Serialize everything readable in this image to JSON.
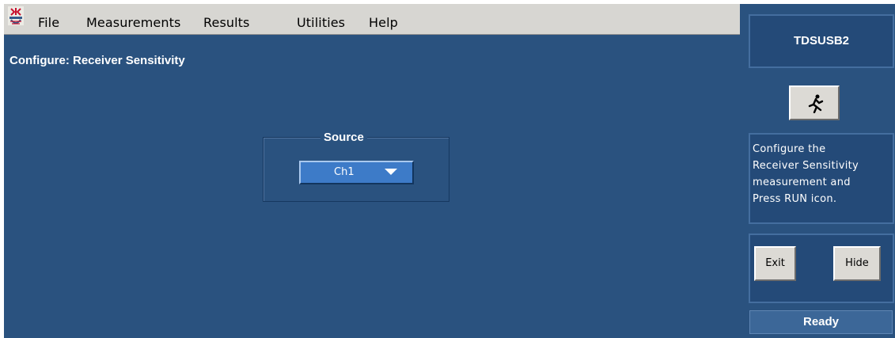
{
  "menu": {
    "items": [
      "File",
      "Measurements",
      "Results",
      "Utilities",
      "Help"
    ]
  },
  "main": {
    "title": "Configure: Receiver Sensitivity",
    "source": {
      "label": "Source",
      "selected": "Ch1"
    }
  },
  "sidebar": {
    "app_name": "TDSUSB2",
    "run_icon": "running-man-icon",
    "help_lines": [
      "Configure the",
      "Receiver Sensitivity",
      "measurement and",
      "Press RUN icon."
    ],
    "exit_label": "Exit",
    "hide_label": "Hide",
    "status": "Ready"
  },
  "colors": {
    "background": "#2a527f",
    "menubar": "#d7d6d2",
    "dropdown": "#3d7bc8",
    "button": "#dcdad5"
  }
}
